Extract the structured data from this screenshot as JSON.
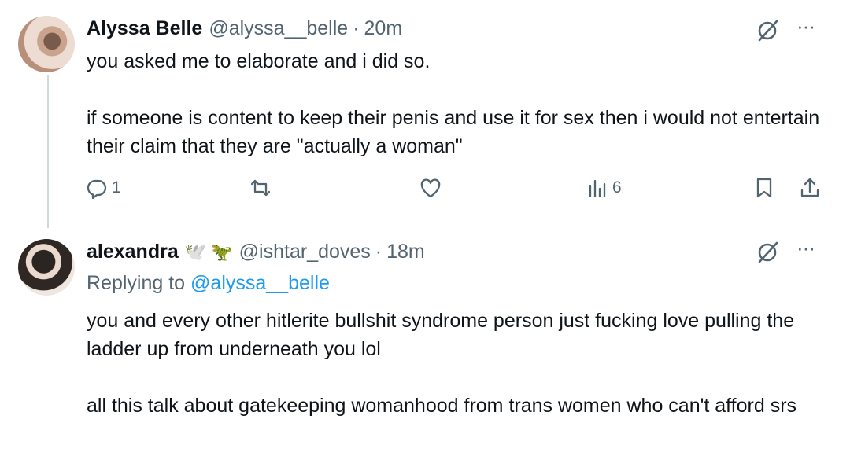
{
  "tweets": [
    {
      "author_name": "Alyssa Belle",
      "handle": "@alyssa__belle",
      "time": "20m",
      "body_lines": [
        "you asked me to elaborate and i did so.",
        "if someone is content to keep their penis and use it for sex then i would not entertain their claim that they are \"actually a woman\""
      ],
      "actions": {
        "replies": "1",
        "views": "6"
      }
    },
    {
      "author_name": "alexandra",
      "name_emojis": "🕊️ 🦖",
      "handle": "@ishtar_doves",
      "time": "18m",
      "replying_to_label": "Replying to",
      "replying_to_handle": "@alyssa__belle",
      "body_lines": [
        "you and every other hitlerite bullshit syndrome person just fucking love pulling the ladder up from underneath you lol",
        "all this talk about gatekeeping womanhood from trans women who can't afford srs"
      ]
    }
  ],
  "separator_dot": "·",
  "more_glyph": "···",
  "icons": [
    "grok-icon",
    "more-icon",
    "reply-icon",
    "retweet-icon",
    "like-icon",
    "views-icon",
    "bookmark-icon",
    "share-icon"
  ]
}
